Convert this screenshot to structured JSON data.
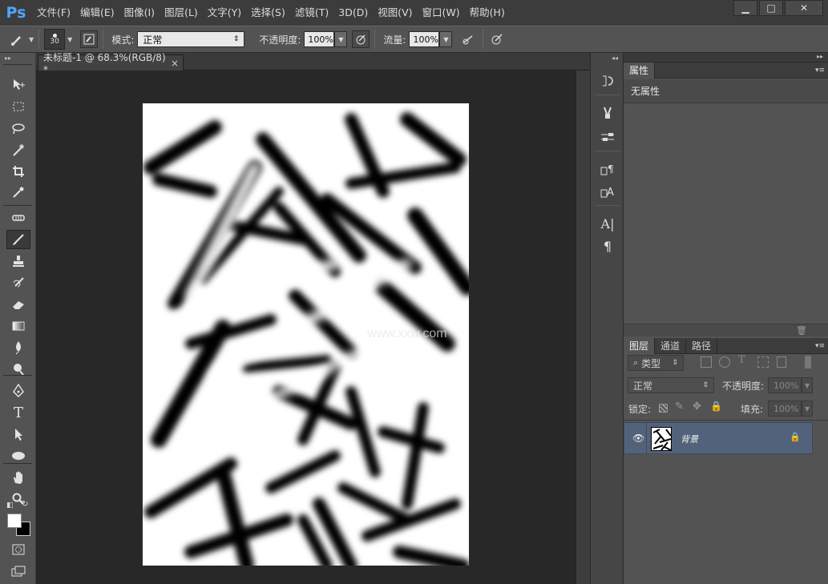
{
  "app": {
    "logo": "Ps"
  },
  "menu": [
    "文件(F)",
    "编辑(E)",
    "图像(I)",
    "图层(L)",
    "文字(Y)",
    "选择(S)",
    "滤镜(T)",
    "3D(D)",
    "视图(V)",
    "窗口(W)",
    "帮助(H)"
  ],
  "window_buttons": {
    "minimize": "▁",
    "maximize": "□",
    "close": "✕"
  },
  "options": {
    "brush_size": "30",
    "mode_label": "模式:",
    "mode_value": "正常",
    "opacity_label": "不透明度:",
    "opacity_value": "100%",
    "flow_label": "流量:",
    "flow_value": "100%"
  },
  "document": {
    "tab_title": "未标题-1 @ 68.3%(RGB/8) *",
    "tab_close": "×",
    "watermark": "www.xxw.com"
  },
  "properties": {
    "tab": "属性",
    "content": "无属性"
  },
  "layers_panel": {
    "tabs": [
      "图层",
      "通道",
      "路径"
    ],
    "filter_label": "类型",
    "blend_mode": "正常",
    "opacity_label": "不透明度:",
    "opacity_value": "100%",
    "lock_label": "锁定:",
    "fill_label": "填充:",
    "fill_value": "100%",
    "layers": [
      {
        "name": "背景",
        "visible": true,
        "locked": true
      }
    ]
  },
  "colors": {
    "ps_blue": "#4ea4ff",
    "panel_bg": "#535353",
    "doc_bg": "#282828",
    "layer_selected": "#52627a"
  },
  "icons": {
    "tools": [
      "move-icon",
      "marquee-icon",
      "lasso-icon",
      "magic-wand-icon",
      "crop-icon",
      "eyedropper-icon",
      "healing-icon",
      "brush-icon",
      "clone-stamp-icon",
      "history-brush-icon",
      "eraser-icon",
      "gradient-icon",
      "blur-icon",
      "dodge-icon",
      "pen-icon",
      "type-icon",
      "path-select-icon",
      "ellipse-icon",
      "hand-icon",
      "zoom-icon"
    ]
  }
}
